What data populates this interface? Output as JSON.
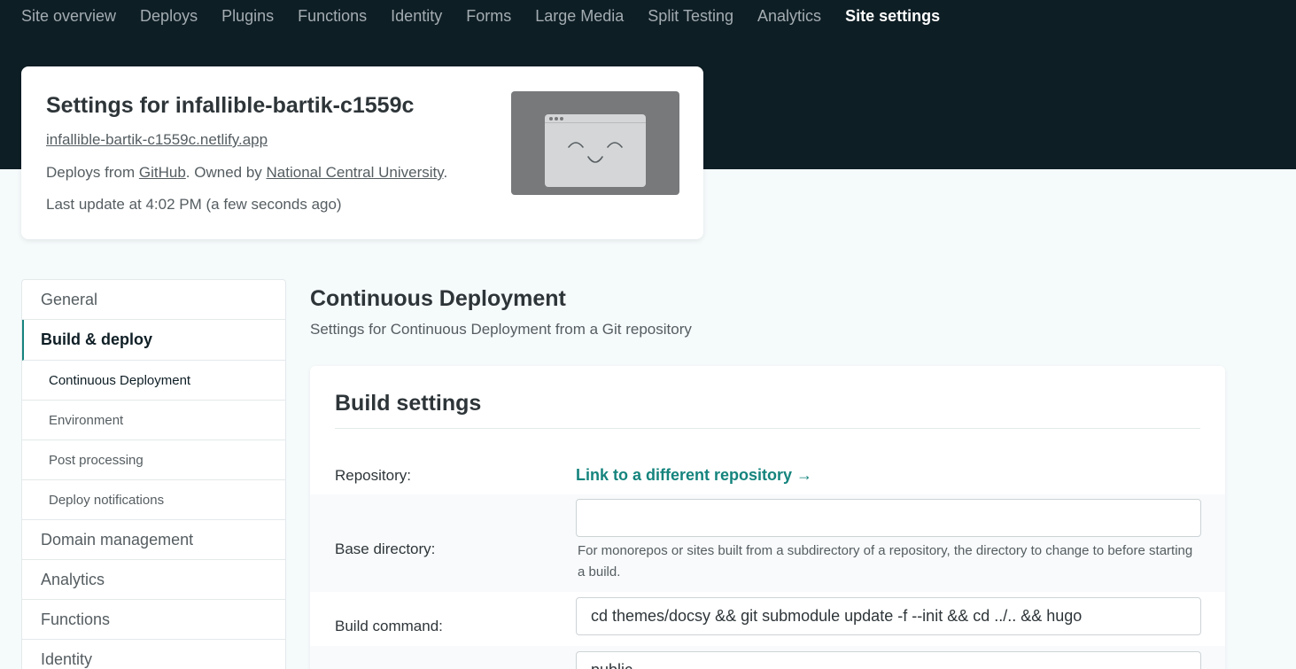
{
  "nav": {
    "items": [
      {
        "label": "Site overview",
        "active": false
      },
      {
        "label": "Deploys",
        "active": false
      },
      {
        "label": "Plugins",
        "active": false
      },
      {
        "label": "Functions",
        "active": false
      },
      {
        "label": "Identity",
        "active": false
      },
      {
        "label": "Forms",
        "active": false
      },
      {
        "label": "Large Media",
        "active": false
      },
      {
        "label": "Split Testing",
        "active": false
      },
      {
        "label": "Analytics",
        "active": false
      },
      {
        "label": "Site settings",
        "active": true
      }
    ]
  },
  "site": {
    "title": "Settings for infallible-bartik-c1559c",
    "url": "infallible-bartik-c1559c.netlify.app",
    "deploys_prefix": "Deploys from ",
    "deploys_source": "GitHub",
    "owned_prefix": ". Owned by ",
    "owner": "National Central University",
    "owned_suffix": ".",
    "last_update": "Last update at 4:02 PM (a few seconds ago)"
  },
  "sidebar": {
    "items": [
      {
        "label": "General"
      },
      {
        "label": "Build & deploy"
      },
      {
        "label": "Continuous Deployment"
      },
      {
        "label": "Environment"
      },
      {
        "label": "Post processing"
      },
      {
        "label": "Deploy notifications"
      },
      {
        "label": "Domain management"
      },
      {
        "label": "Analytics"
      },
      {
        "label": "Functions"
      },
      {
        "label": "Identity"
      }
    ]
  },
  "section": {
    "title": "Continuous Deployment",
    "subtitle": "Settings for Continuous Deployment from a Git repository"
  },
  "build_settings": {
    "title": "Build settings",
    "repository_label": "Repository:",
    "repository_link": "Link to a different repository →",
    "base_directory_label": "Base directory:",
    "base_directory_value": "",
    "base_directory_help": "For monorepos or sites built from a subdirectory of a repository, the directory to change to before starting a build.",
    "build_command_label": "Build command:",
    "build_command_value": "cd themes/docsy && git submodule update -f --init && cd ../.. && hugo",
    "publish_directory_value": "public"
  },
  "colors": {
    "topbar": "#0e1e25",
    "accent": "#15847d",
    "nav_active": "#ffffff",
    "nav_inactive": "#a3acb1"
  }
}
